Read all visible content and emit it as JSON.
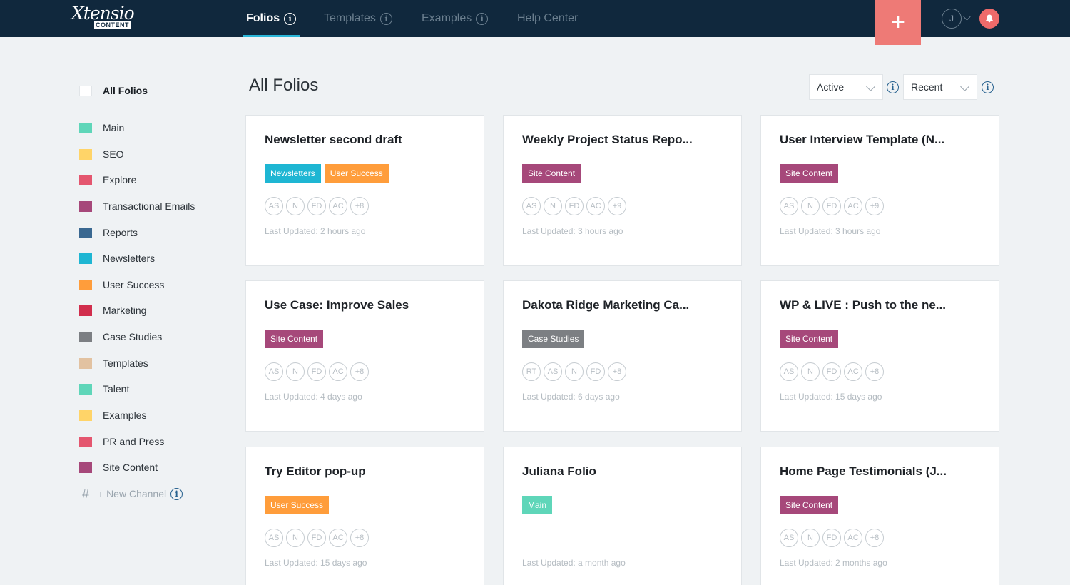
{
  "brand": {
    "script": "Xtensio",
    "box": "CONTENT"
  },
  "nav": {
    "tabs": [
      {
        "label": "Folios"
      },
      {
        "label": "Templates"
      },
      {
        "label": "Examples"
      },
      {
        "label": "Help Center"
      }
    ],
    "add_symbol": "+",
    "avatar_initial": "J"
  },
  "sidebar": {
    "all_label": "All Folios",
    "items": [
      {
        "label": "Main",
        "color": "#5fd6b9"
      },
      {
        "label": "SEO",
        "color": "#ffd468"
      },
      {
        "label": "Explore",
        "color": "#e4566f"
      },
      {
        "label": "Transactional Emails",
        "color": "#a6487a"
      },
      {
        "label": "Reports",
        "color": "#3a6891"
      },
      {
        "label": "Newsletters",
        "color": "#1eb6d3"
      },
      {
        "label": "User Success",
        "color": "#ff9d3b"
      },
      {
        "label": "Marketing",
        "color": "#d12e4d"
      },
      {
        "label": "Case Studies",
        "color": "#7c7f83"
      },
      {
        "label": "Templates",
        "color": "#e2c2a1"
      },
      {
        "label": "Talent",
        "color": "#5fd6b9"
      },
      {
        "label": "Examples",
        "color": "#ffd468"
      },
      {
        "label": "PR and Press",
        "color": "#e4566f"
      },
      {
        "label": "Site Content",
        "color": "#a6487a"
      }
    ],
    "new_channel": "+ New Channel",
    "hash": "#"
  },
  "main": {
    "title": "All Folios",
    "filter_status": "Active",
    "sort": "Recent"
  },
  "cards": [
    {
      "title": "Newsletter second draft",
      "tags": [
        {
          "label": "Newsletters",
          "color": "#1eb6d3"
        },
        {
          "label": "User Success",
          "color": "#ff9d3b"
        }
      ],
      "avatars": [
        "AS",
        "N",
        "FD",
        "AC",
        "+8"
      ],
      "updated": "Last Updated: 2 hours ago"
    },
    {
      "title": "Weekly Project Status Repo...",
      "tags": [
        {
          "label": "Site Content",
          "color": "#a6487a"
        }
      ],
      "avatars": [
        "AS",
        "N",
        "FD",
        "AC",
        "+9"
      ],
      "updated": "Last Updated: 3 hours ago"
    },
    {
      "title": "User Interview Template (N...",
      "tags": [
        {
          "label": "Site Content",
          "color": "#a6487a"
        }
      ],
      "avatars": [
        "AS",
        "N",
        "FD",
        "AC",
        "+9"
      ],
      "updated": "Last Updated: 3 hours ago"
    },
    {
      "title": "Use Case: Improve Sales",
      "tags": [
        {
          "label": "Site Content",
          "color": "#a6487a"
        }
      ],
      "avatars": [
        "AS",
        "N",
        "FD",
        "AC",
        "+8"
      ],
      "updated": "Last Updated: 4 days ago"
    },
    {
      "title": "Dakota Ridge Marketing Ca...",
      "tags": [
        {
          "label": "Case Studies",
          "color": "#7c7f83"
        }
      ],
      "avatars": [
        "RT",
        "AS",
        "N",
        "FD",
        "+8"
      ],
      "updated": "Last Updated: 6 days ago"
    },
    {
      "title": "WP & LIVE : Push to the ne...",
      "tags": [
        {
          "label": "Site Content",
          "color": "#a6487a"
        }
      ],
      "avatars": [
        "AS",
        "N",
        "FD",
        "AC",
        "+8"
      ],
      "updated": "Last Updated: 15 days ago"
    },
    {
      "title": "Try Editor pop-up",
      "tags": [
        {
          "label": "User Success",
          "color": "#ff9d3b"
        }
      ],
      "avatars": [
        "AS",
        "N",
        "FD",
        "AC",
        "+8"
      ],
      "updated": "Last Updated: 15 days ago"
    },
    {
      "title": "Juliana Folio",
      "tags": [
        {
          "label": "Main",
          "color": "#5fd6b9"
        }
      ],
      "avatars": [],
      "updated": "Last Updated: a month ago"
    },
    {
      "title": "Home Page Testimonials (J...",
      "tags": [
        {
          "label": "Site Content",
          "color": "#a6487a"
        }
      ],
      "avatars": [
        "AS",
        "N",
        "FD",
        "AC",
        "+8"
      ],
      "updated": "Last Updated: 2 months ago"
    }
  ]
}
